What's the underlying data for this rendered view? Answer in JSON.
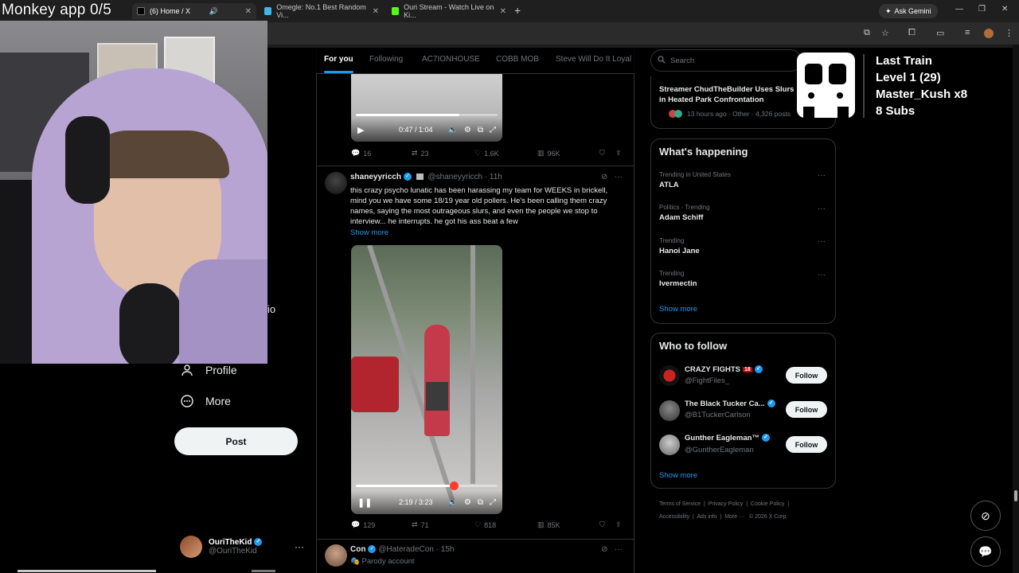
{
  "browser": {
    "tabs": [
      {
        "label": "(6) Home / X",
        "icon": "x-icon",
        "color": "#000000"
      },
      {
        "label": "Omegle: No.1 Best Random Vi...",
        "icon": "omegle-icon",
        "color": "#44b3e7"
      },
      {
        "label": "Ouri Stream - Watch Live on Ki...",
        "icon": "kick-icon",
        "color": "#53fc18"
      }
    ],
    "ask_gemini": "Ask Gemini"
  },
  "webcam": {
    "overlay_text": "Monkey app 0/5"
  },
  "left_nav": {
    "partial_label": "io",
    "profile": "Profile",
    "more": "More",
    "post_button": "Post",
    "account": {
      "name": "OuriTheKid",
      "handle": "@OuriTheKid"
    }
  },
  "feed": {
    "tabs": [
      "For you",
      "Following",
      "AC7IONHOUSE",
      "COBB MOB",
      "Steve Will Do It Loyal"
    ],
    "active_tab": "For you",
    "tweet1": {
      "video": {
        "time": "0:47 / 1:04",
        "progress": 0.73
      },
      "replies": "16",
      "reposts": "23",
      "likes": "1.6K",
      "views": "96K"
    },
    "tweet2": {
      "name": "shaneyyricch",
      "handle": "@shaneyyricch",
      "age": "11h",
      "text": "this crazy psycho lunatic has been harassing my team for WEEKS in brickell, mind you we have some 18/19 year old pollers. He's been calling them crazy names, saying the most outrageous slurs, and even the people we stop to interview... he interrupts. he got his ass beat a few",
      "show_more": "Show more",
      "video": {
        "time": "2:19 / 3:23",
        "progress": 0.69
      },
      "replies": "129",
      "reposts": "71",
      "likes": "818",
      "views": "85K"
    },
    "tweet3": {
      "name": "Con",
      "handle": "@HateradeCon",
      "age": "15h",
      "label": "Parody account"
    }
  },
  "right": {
    "search_placeholder": "Search",
    "news": {
      "title": "Streamer ChudTheBuilder Uses Slurs in Heated Park Confrontation",
      "meta": "13 hours ago · Other · 4,326 posts"
    },
    "whats_happening": {
      "title": "What's happening",
      "trends": [
        {
          "meta": "Trending in United States",
          "name": "ATLA"
        },
        {
          "meta": "Politics · Trending",
          "name": "Adam Schiff"
        },
        {
          "meta": "Trending",
          "name": "Hanoi Jane"
        },
        {
          "meta": "Trending",
          "name": "Ivermectin"
        }
      ],
      "show_more": "Show more"
    },
    "who_to_follow": {
      "title": "Who to follow",
      "accounts": [
        {
          "name": "CRAZY FIGHTS",
          "badge": "18",
          "handle": "@FightFiles_",
          "button": "Follow"
        },
        {
          "name": "The Black Tucker Ca...",
          "handle": "@B1TuckerCarlson",
          "button": "Follow"
        },
        {
          "name": "Gunther Eagleman™",
          "handle": "@GuntherEagleman",
          "button": "Follow"
        }
      ],
      "show_more": "Show more"
    },
    "footer": {
      "line1": [
        "Terms of Service",
        "Privacy Policy",
        "Cookie Policy"
      ],
      "line2": [
        "Accessibility",
        "Ads info",
        "More ···",
        "© 2026 X Corp."
      ]
    }
  },
  "stream_overlay": {
    "lines": [
      "Last Train",
      "Level 1  (29)",
      "Master_Kush x8",
      "8 Subs"
    ]
  }
}
